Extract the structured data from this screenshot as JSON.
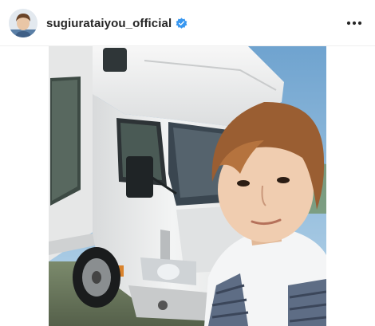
{
  "post": {
    "username": "sugiurataiyou_official",
    "verified": true,
    "avatar_icon": "profile-photo",
    "more_icon": "more-horizontal-icon",
    "verified_icon": "verified-badge-icon"
  },
  "colors": {
    "verified_blue": "#3897f0",
    "text": "#262626",
    "divider": "#efefef"
  }
}
